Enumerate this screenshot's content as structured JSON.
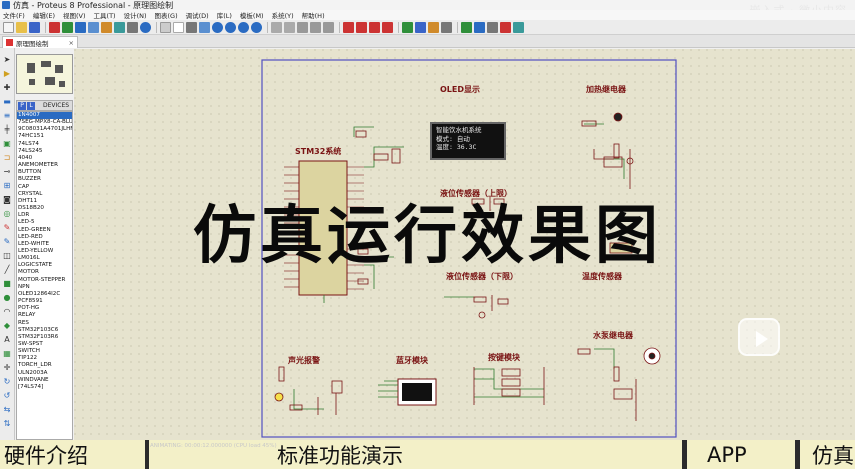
{
  "window": {
    "title": "仿真 - Proteus 8 Professional - 原理图绘制",
    "watermark": "嵌入式 · 微小内容"
  },
  "menu": [
    "文件(F)",
    "编辑(E)",
    "视图(V)",
    "工具(T)",
    "设计(N)",
    "图表(G)",
    "调试(D)",
    "库(L)",
    "模板(M)",
    "系统(Y)",
    "帮助(H)"
  ],
  "tab": {
    "label": "原理图绘制"
  },
  "devices": {
    "header": "DEVICES",
    "items": [
      "1N4007",
      "7SEG-MPX8-CA-BLUE",
      "9C08031A4701JLHFT",
      "74HC151",
      "74LS74",
      "74LS245",
      "4040",
      "ANEMOMETER",
      "BUTTON",
      "BUZZER",
      "CAP",
      "CRYSTAL",
      "DHT11",
      "DS18B20",
      "LDR",
      "LED-5",
      "LED-GREEN",
      "LED-RED",
      "LED-WHITE",
      "LED-YELLOW",
      "LM016L",
      "LOGICSTATE",
      "MOTOR",
      "MOTOR-STEPPER",
      "NPN",
      "OLED12864I2C",
      "PCF8591",
      "POT-HG",
      "RELAY",
      "RES",
      "STM32F103C6",
      "STM32F103R6",
      "SW-SPST",
      "SWITCH",
      "TIP122",
      "TORCH_LDR",
      "ULN2003A",
      "WINDVANE",
      "[74LS74]"
    ],
    "selected_index": 0
  },
  "schematic": {
    "labels": {
      "oled": "OLED显示",
      "stm32": "STM32系统",
      "heat_relay": "加热继电器",
      "level_up": "液位传感器（上限）",
      "level_down": "液位传感器（下限）",
      "temp": "温度传感器",
      "pump_relay": "水泵继电器",
      "alarm": "声光报警",
      "bt": "蓝牙模块",
      "keys": "按键模块"
    },
    "oled_lines": [
      "智能饮水机系统",
      "模式: 自动",
      "温度: 36.3C"
    ]
  },
  "overlay": {
    "text": "仿真运行效果图"
  },
  "bottom_bar": {
    "segments": [
      "硬件介绍",
      "标准功能演示",
      "APP",
      "仿真"
    ],
    "status": "ANIMATING: 00:00:12.000000 (CPU load 45%)"
  }
}
